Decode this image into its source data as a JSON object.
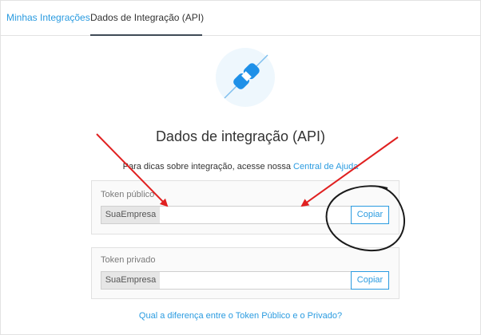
{
  "tabs": [
    {
      "label": "Minhas Integrações",
      "active": false
    },
    {
      "label": "Dados de Integração (API)",
      "active": true
    }
  ],
  "logo": {
    "icon": "integration-link-icon",
    "color": "#1e90e8"
  },
  "heading": "Dados de integração (API)",
  "help": {
    "text": "Para dicas sobre integração, acesse nossa ",
    "link": "Central de Ajuda"
  },
  "public_token": {
    "label": "Token público",
    "addon": "SuaEmpresa",
    "value": "",
    "copy_label": "Copiar"
  },
  "private_token": {
    "label": "Token privado",
    "addon": "SuaEmpresa",
    "value": "",
    "copy_label": "Copiar"
  },
  "diff_link": "Qual a diferença entre o Token Público e o Privado?",
  "annotations": {
    "arrow_color": "#e02020",
    "circle_color": "#1a1a1a"
  },
  "colors": {
    "accent": "#2a9be0",
    "tab_underline": "#3f4a56"
  }
}
